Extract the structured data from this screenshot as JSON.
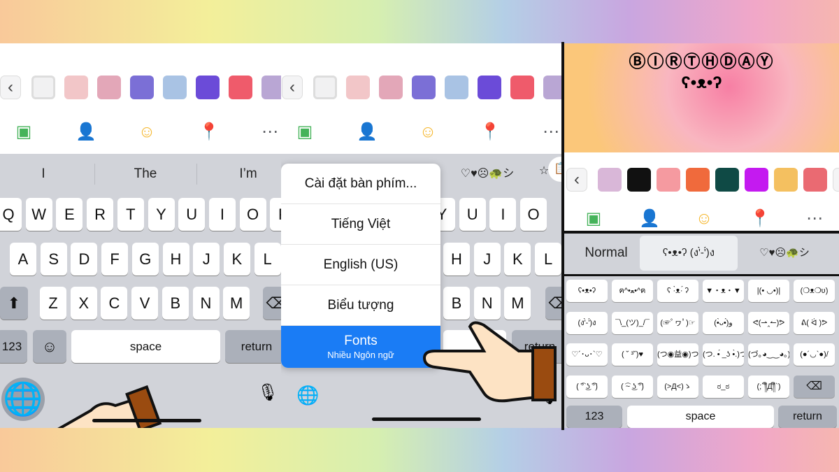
{
  "panel1": {
    "suggestions": [
      "I",
      "The",
      "I’m"
    ],
    "rows": [
      [
        "Q",
        "W",
        "E",
        "R",
        "T",
        "Y",
        "U",
        "I",
        "O",
        "P"
      ],
      [
        "A",
        "S",
        "D",
        "F",
        "G",
        "H",
        "J",
        "K",
        "L"
      ],
      [
        "Z",
        "X",
        "C",
        "V",
        "B",
        "N",
        "M"
      ]
    ],
    "numbers_key": "123",
    "space_key": "space",
    "return_key": "return"
  },
  "panel2": {
    "menu": [
      {
        "label": "Cài đặt bàn phím..."
      },
      {
        "label": "Tiếng Việt"
      },
      {
        "label": "English (US)"
      },
      {
        "label": "Biểu tượng"
      },
      {
        "label": "Fonts",
        "sub": "Nhiều Ngôn ngữ",
        "selected": true
      }
    ],
    "row1": [
      "Y",
      "U",
      "I",
      "O"
    ],
    "row2": [
      "H",
      "J",
      "K",
      "L"
    ],
    "row3": [
      "B",
      "N",
      "M"
    ],
    "symbols_suggestion": "♡♥☹🐢シ",
    "return_key": "return"
  },
  "panel3": {
    "card_title": "ⒷⒾⓇⓉⒽⒹⒶⓎ",
    "card_text": "ʕ•ᴥ•ʔ",
    "font_tabs": [
      "Normal",
      "ʕ•ᴥ•ʔ (ง'̀-'́)ง",
      "♡♥☹🐢シ"
    ],
    "selected_tab": 1,
    "emoticons": [
      "ʕ•ᴥ•ʔ",
      "ฅ^•ﻌ•^ฅ",
      "ʕ ·̀ᴥ·́ ʔ",
      "▼・ᴥ・▼",
      "|(• ◡•)|",
      "(❍ᴥ❍ʋ)",
      "(ง'̀-'́)ง",
      "¯\\_(ツ)_/¯",
      "(☞ﾟヮﾟ)☞",
      "(•̀ᴗ•́)و",
      "ᕙ(⇀‸↼)ᕗ",
      "ᕕ( ᐛ )ᕗ",
      "♡´･ᴗ･`♡",
      "( ˘ ³˘)♥",
      "(つ◉益◉)つ",
      "(つ. •́ _ʖ •̀.)つ",
      "(づ｡◕‿‿◕｡)づ",
      "(●´◡`●)/",
      "( ͡° ͜ʖ ͡°)",
      "( ͡~ ͜ʖ ͡°)",
      "(>Д<)ゝ",
      "ಠ_ಠ",
      "(;´༎ຶД༎ຶ`)",
      "⌫"
    ],
    "numbers_key": "123",
    "space_key": "space",
    "return_key": "return"
  },
  "swatch_colors": [
    "#f1f1f2",
    "#f2c6c8",
    "#e3a7b8",
    "#7b6fd6",
    "#a9c3e4",
    "#6b4bd8",
    "#ef5b6b",
    "#b9a6d4"
  ],
  "panel3_swatch_colors": [
    "#d9b7d8",
    "#111111",
    "#f59aa0",
    "#f06a3c",
    "#0f4a45",
    "#c41af0",
    "#f4c060",
    "#ea6a72"
  ],
  "colors": {
    "accent": "#1a7cf5",
    "keyboard_bg": "#d1d3d9",
    "photo": "#45b35a",
    "tag": "#1877f2",
    "feeling": "#f5b62a",
    "location": "#f0513a",
    "more": "#5f6166"
  }
}
